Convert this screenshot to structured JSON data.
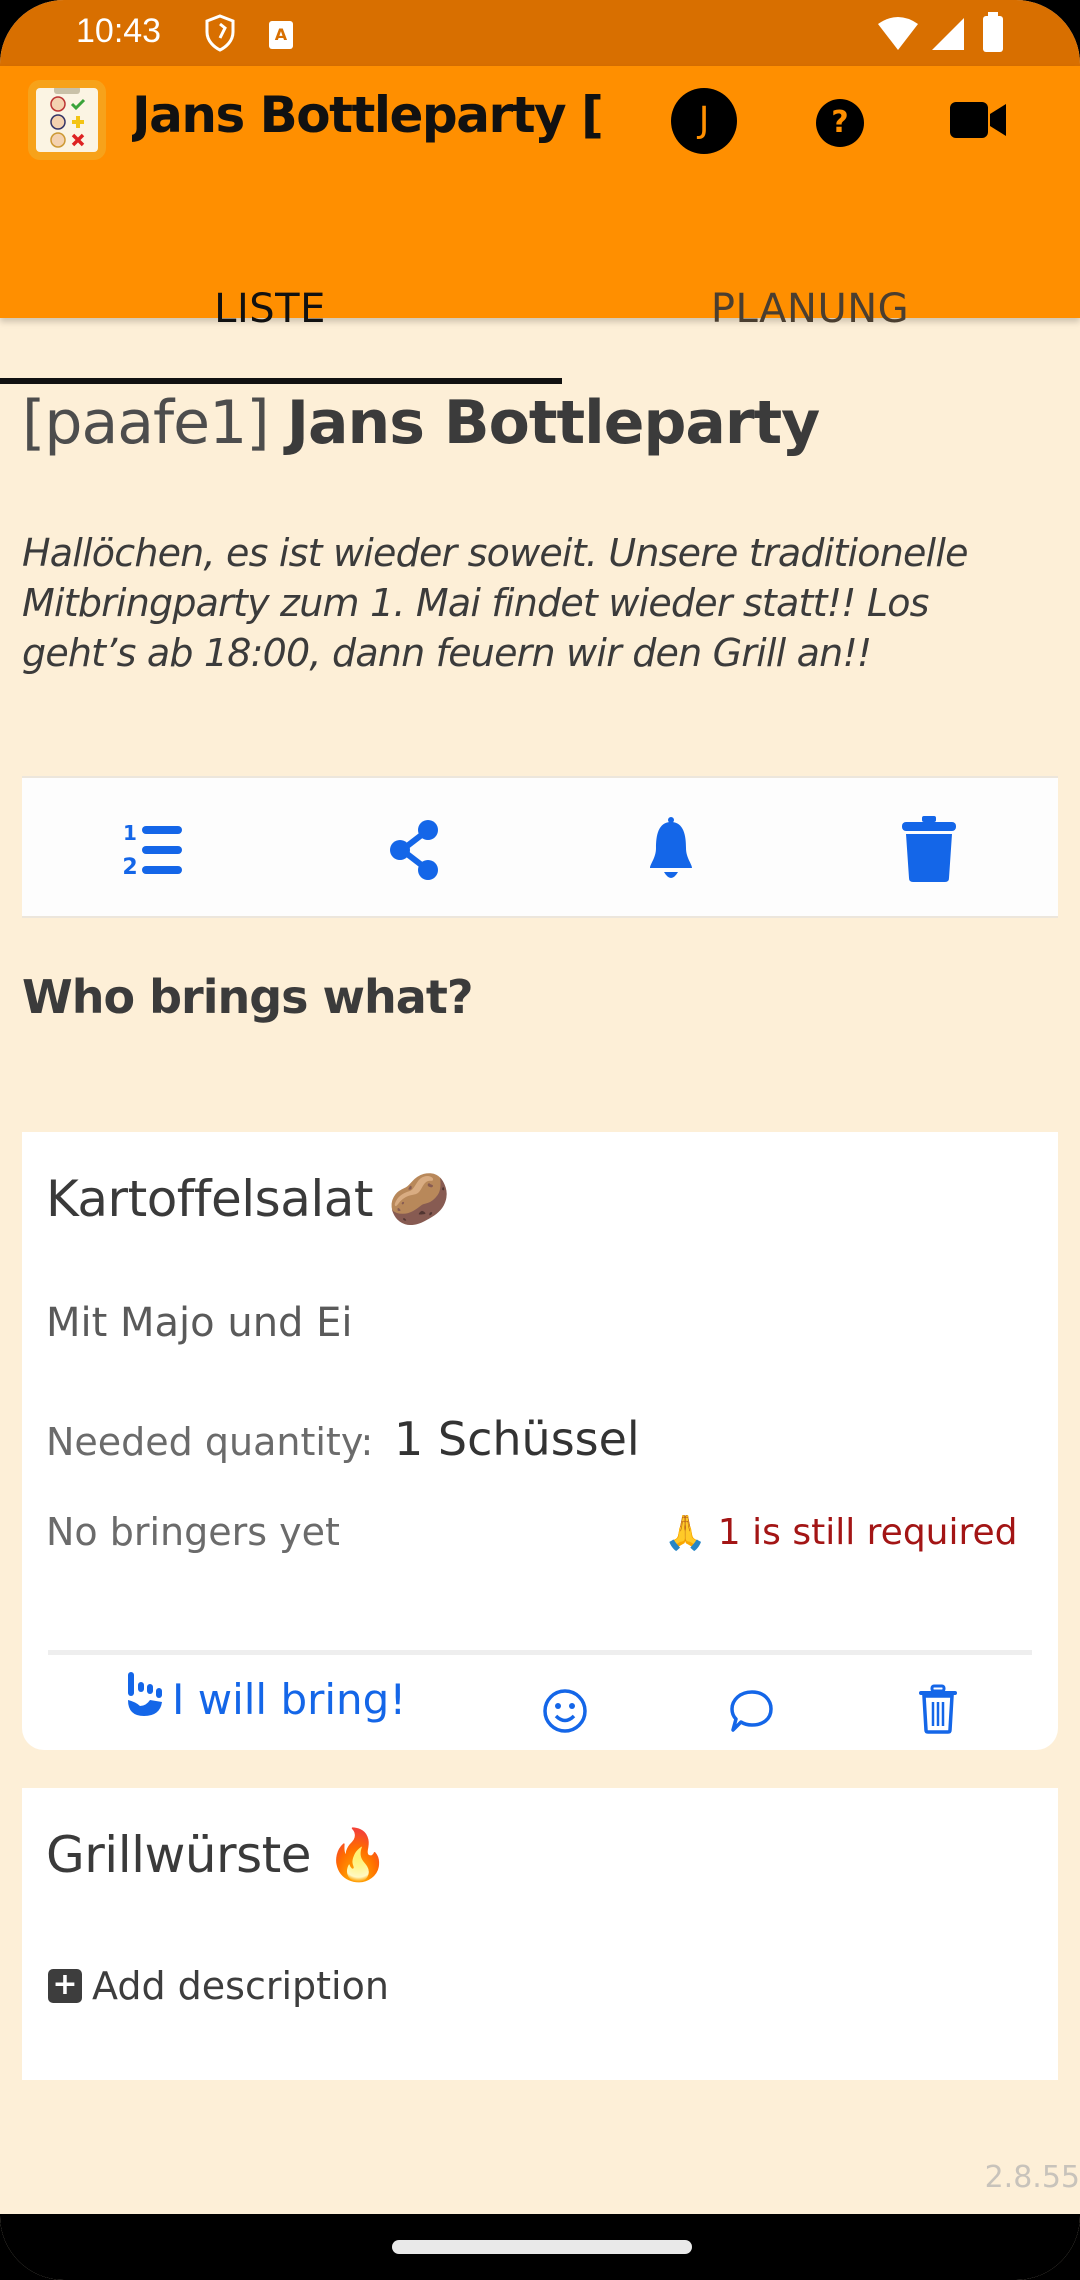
{
  "status_bar": {
    "time": "10:43",
    "icons": [
      "shield-icon",
      "keyboard-a-icon",
      "wifi-icon",
      "signal-icon",
      "battery-icon"
    ]
  },
  "app_bar": {
    "title": "Jans Bottleparty […",
    "avatar_initial": "J",
    "help_label": "?",
    "icons": [
      "app-logo",
      "avatar",
      "help-icon",
      "video-icon"
    ]
  },
  "tabs": [
    {
      "label": "LISTE",
      "active": true
    },
    {
      "label": "PLANUNG",
      "active": false
    }
  ],
  "event": {
    "code": "[paafe1]",
    "name": "Jans Bottleparty",
    "description": "Hallöchen, es ist wieder soweit. Unsere traditionelle Mitbringparty zum 1. Mai findet wieder statt!! Los geht’s ab 18:00, dann feuern wir den Grill an!!"
  },
  "toolbar": {
    "buttons": [
      "numbered-list-icon",
      "share-icon",
      "bell-icon",
      "trash-icon"
    ]
  },
  "section_title": "Who brings what?",
  "items": [
    {
      "title": "Kartoffelsalat",
      "emoji": "🥔",
      "description": "Mit Majo und Ei",
      "quantity_label": "Needed quantity:",
      "quantity_value": "1 Schüssel",
      "bringers_status": "No bringers yet",
      "required_emoji": "🙏",
      "required_text": "1 is still required",
      "bring_label": "I will bring!",
      "actions": [
        "bring-hand-icon",
        "smiley-icon",
        "comment-icon",
        "trash-icon"
      ]
    },
    {
      "title": "Grillwürste",
      "emoji": "🔥",
      "add_description_label": "Add description"
    }
  ],
  "version": "2.8.55",
  "colors": {
    "primary": "#ff8f00",
    "status_bar": "#d86f00",
    "background": "#fdefd7",
    "accent_blue": "#1466e8",
    "required_red": "#a31515"
  }
}
